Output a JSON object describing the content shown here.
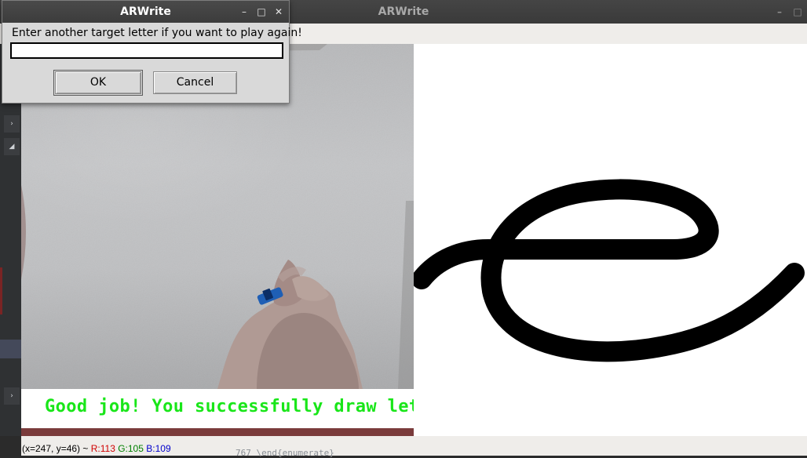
{
  "main_window": {
    "title": "ARWrite",
    "controls": {
      "minimize": "–",
      "maximize": "□"
    }
  },
  "dialog": {
    "title": "ARWrite",
    "controls": {
      "minimize": "–",
      "maximize": "□",
      "close": "✕"
    },
    "prompt": "Enter another target letter if you want to play again!",
    "input_value": "",
    "ok_label": "OK",
    "cancel_label": "Cancel"
  },
  "camera": {
    "message": "Good job! You successfully draw letter e"
  },
  "target": {
    "letter": "e"
  },
  "status_bar": {
    "coords": "(x=247, y=46) ~ ",
    "r": "R:113",
    "g": "G:105",
    "b": "B:109"
  },
  "background_code": "767          \\end{enumerate}",
  "left_strip": {
    "icons": [
      "chevron-right-icon",
      "expand-icon",
      "chevron-right-icon"
    ]
  },
  "colors": {
    "message_green": "#19e619",
    "status_r": "#d00000",
    "status_g": "#008000",
    "status_b": "#0000cc"
  }
}
